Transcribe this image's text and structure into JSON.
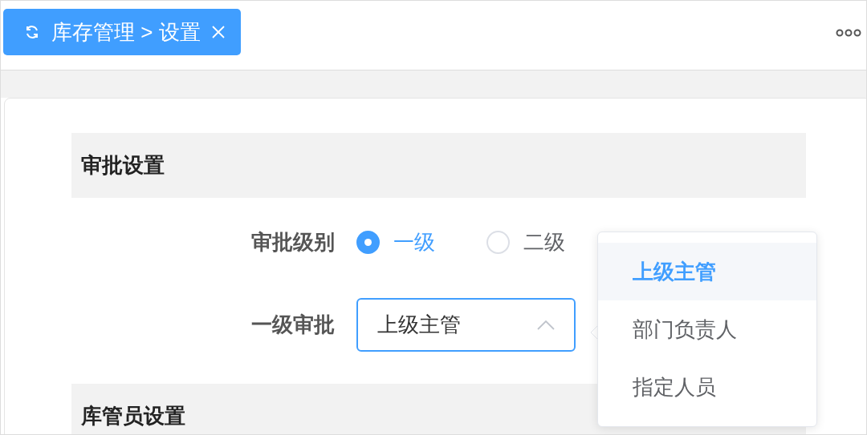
{
  "tabs": [
    {
      "label": "库存管理 > 设置",
      "selected": true
    }
  ],
  "sections": [
    {
      "title": "审批设置",
      "fields": [
        {
          "kind": "radio",
          "label": "审批级别",
          "options": [
            {
              "label": "一级",
              "selected": true
            },
            {
              "label": "二级",
              "selected": false
            }
          ]
        },
        {
          "kind": "select",
          "label": "一级审批",
          "value": "上级主管",
          "expanded": true,
          "options": [
            {
              "label": "上级主管",
              "selected": true
            },
            {
              "label": "部门负责人",
              "selected": false
            },
            {
              "label": "指定人员",
              "selected": false
            }
          ]
        }
      ]
    },
    {
      "title": "库管员设置"
    }
  ]
}
